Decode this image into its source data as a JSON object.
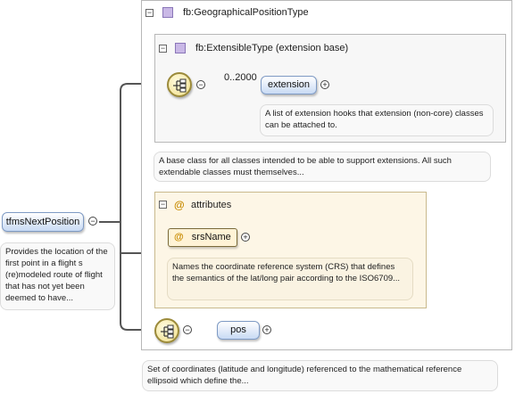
{
  "root": {
    "name": "tfmsNextPosition",
    "doc": "Provides the location of the first point in a flight s (re)modeled route of flight that has not yet been deemed to have..."
  },
  "type": {
    "name": "fb:GeographicalPositionType",
    "doc": "A base class for all classes intended to be able to support extensions. All such extendable classes must themselves..."
  },
  "base": {
    "name": "fb:ExtensibleType (extension base)"
  },
  "extension": {
    "name": "extension",
    "cardinality": "0..2000",
    "doc": "A list of extension hooks that extension (non-core) classes can be attached to."
  },
  "attributes": {
    "header": "attributes",
    "at_symbol": "@",
    "srs": {
      "name": "srsName",
      "doc": "Names the coordinate reference system (CRS) that defines the semantics of the lat/long pair according to the ISO6709..."
    }
  },
  "pos": {
    "name": "pos",
    "doc": "Set of coordinates (latitude and longitude) referenced to the mathematical reference ellipsoid which define the..."
  },
  "symbols": {
    "minus": "−",
    "plus": "+"
  },
  "colors": {
    "element_fill": "#c8daf4",
    "attr_fill": "#fdf6e6",
    "type_icon": "#c9b8e6",
    "connector": "#555555"
  }
}
